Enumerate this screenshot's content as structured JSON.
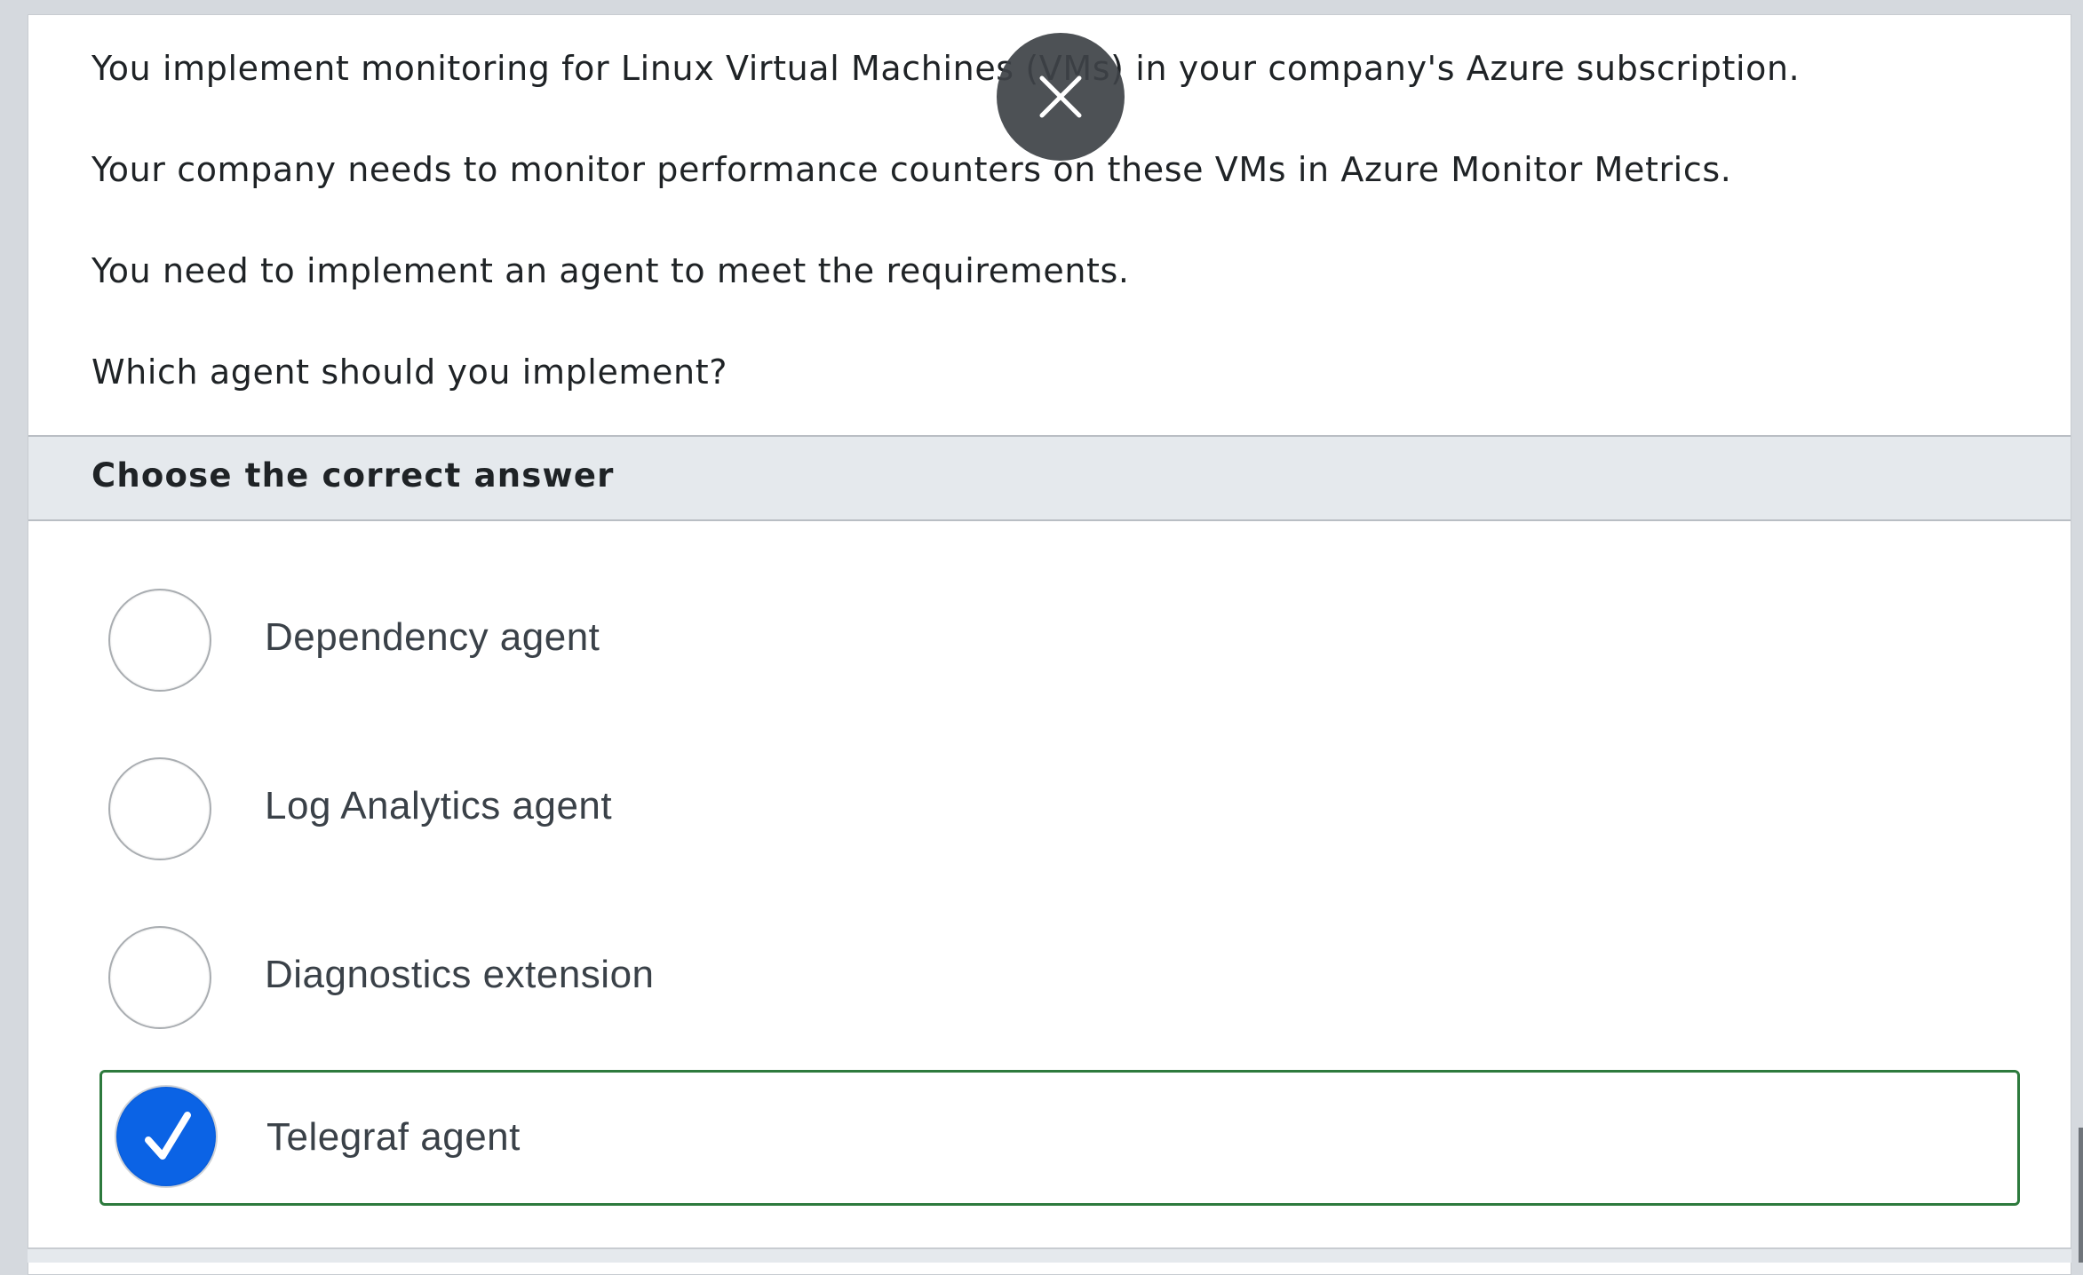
{
  "question": {
    "lines": [
      "You implement monitoring for Linux Virtual Machines (VMs) in your company's Azure subscription.",
      "Your company needs to monitor performance counters on these VMs in Azure Monitor Metrics.",
      "You need to implement an agent to meet the requirements.",
      "Which agent should you implement?"
    ]
  },
  "answers": {
    "header": "Choose the correct answer",
    "options": [
      {
        "label": "Dependency agent",
        "selected": false
      },
      {
        "label": "Log Analytics agent",
        "selected": false
      },
      {
        "label": "Diagnostics extension",
        "selected": false
      },
      {
        "label": "Telegraf agent",
        "selected": true
      }
    ]
  },
  "colors": {
    "selected_radio": "#0b63e5",
    "selected_border": "#2d7a3d",
    "close_button": "#3e4246",
    "header_background": "#e5e9ed"
  },
  "icons": {
    "close": "close-icon",
    "checkmark": "checkmark-icon"
  }
}
